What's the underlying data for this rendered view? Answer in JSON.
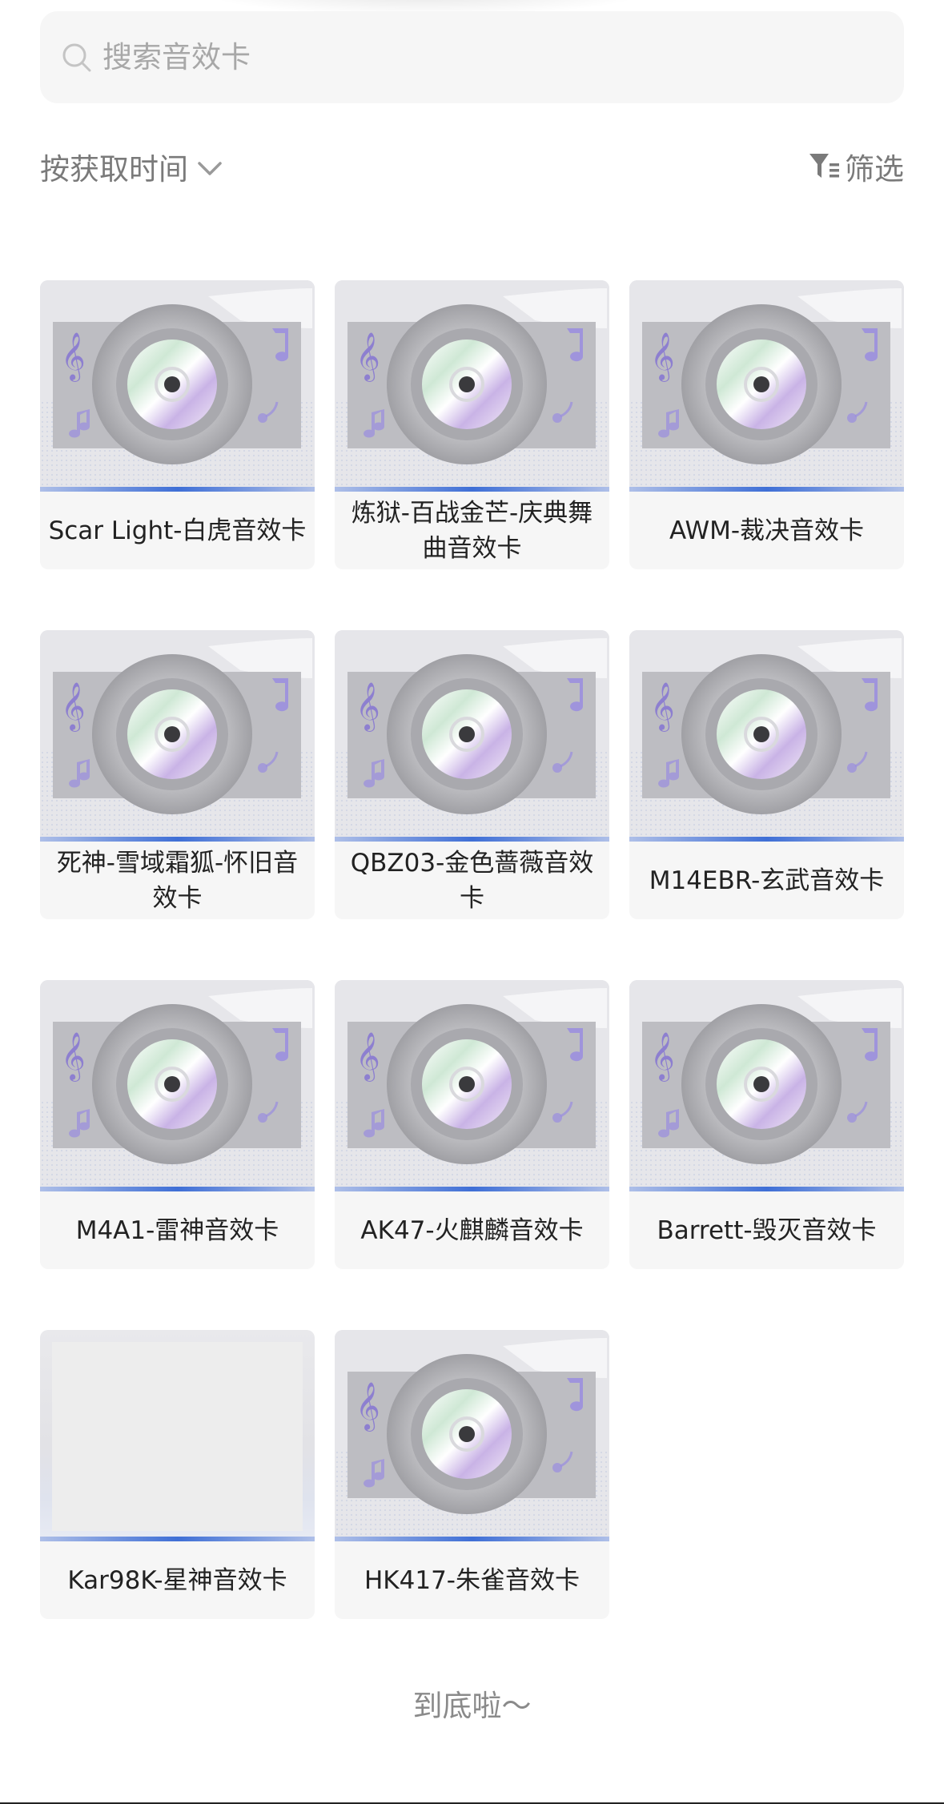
{
  "search": {
    "placeholder": "搜索音效卡",
    "icon": "search-icon"
  },
  "toolbar": {
    "sort_label": "按获取时间",
    "sort_icon": "chevron-down-icon",
    "filter_label": "筛选",
    "filter_icon": "filter-icon"
  },
  "cards": [
    {
      "title": "Scar Light-白虎音效卡",
      "image": "cd-disc"
    },
    {
      "title": "炼狱-百战金芒-庆典舞曲音效卡",
      "image": "cd-disc"
    },
    {
      "title": "AWM-裁决音效卡",
      "image": "cd-disc"
    },
    {
      "title": "死神-雪域霜狐-怀旧音效卡",
      "image": "cd-disc"
    },
    {
      "title": "QBZ03-金色蔷薇音效卡",
      "image": "cd-disc"
    },
    {
      "title": "M14EBR-玄武音效卡",
      "image": "cd-disc"
    },
    {
      "title": "M4A1-雷神音效卡",
      "image": "cd-disc"
    },
    {
      "title": "AK47-火麒麟音效卡",
      "image": "cd-disc"
    },
    {
      "title": "Barrett-毁灭音效卡",
      "image": "cd-disc"
    },
    {
      "title": "Kar98K-星神音效卡",
      "image": "blank"
    },
    {
      "title": "HK417-朱雀音效卡",
      "image": "cd-disc"
    }
  ],
  "footer": {
    "end_text": "到底啦～"
  },
  "colors": {
    "accent_bar": "#3f6fd6",
    "card_bg": "#f6f6f6",
    "muted_text": "#7a7a7a"
  }
}
